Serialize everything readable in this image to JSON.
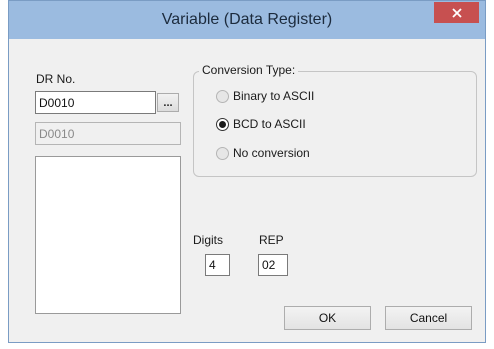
{
  "window": {
    "title": "Variable (Data Register)",
    "close_icon": "close-icon"
  },
  "dr_no": {
    "label": "DR No.",
    "value": "D0010",
    "browse_label": "...",
    "preview_value": "D0010"
  },
  "conversion": {
    "title": "Conversion Type:",
    "options": [
      {
        "label": "Binary to ASCII",
        "selected": false
      },
      {
        "label": "BCD to ASCII",
        "selected": true
      },
      {
        "label": "No conversion",
        "selected": false
      }
    ]
  },
  "digits": {
    "label": "Digits",
    "value": "4"
  },
  "rep": {
    "label": "REP",
    "value": "02"
  },
  "buttons": {
    "ok": "OK",
    "cancel": "Cancel"
  },
  "colors": {
    "titlebar": "#9bbbe0",
    "close_button": "#c75050",
    "dialog_bg": "#f0f0f0"
  }
}
